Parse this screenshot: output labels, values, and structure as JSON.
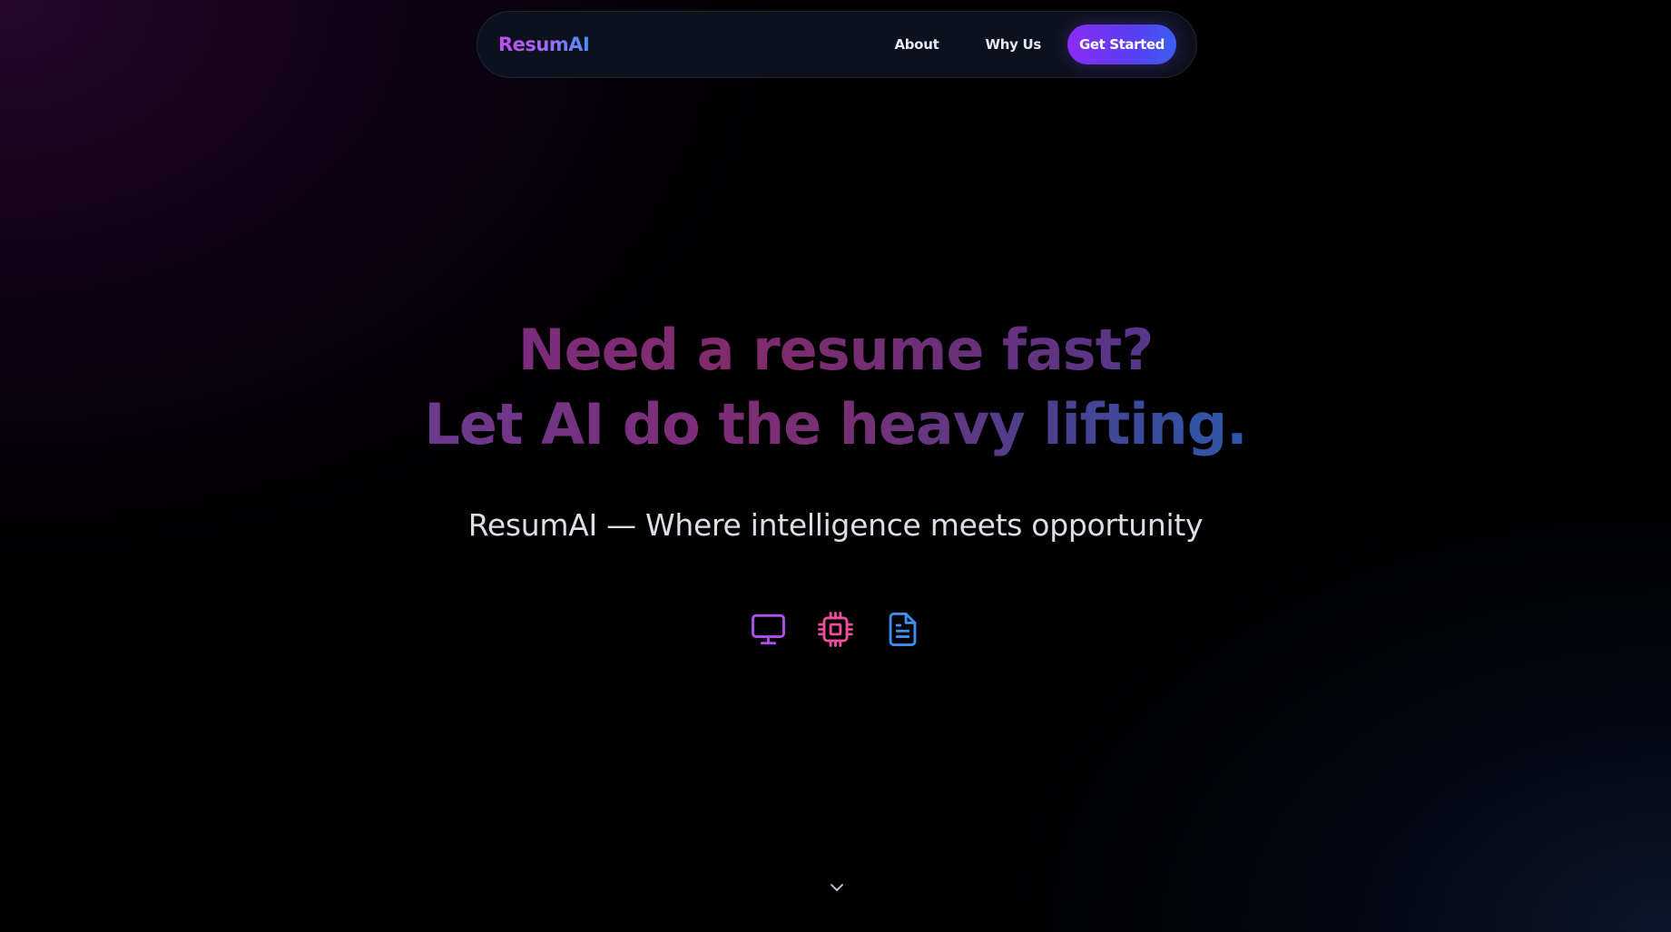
{
  "nav": {
    "logo": "ResumAI",
    "links": [
      {
        "label": "About"
      },
      {
        "label": "Why Us"
      }
    ],
    "cta_label": "Get Started"
  },
  "hero": {
    "line1": "Need a resume fast?",
    "line2": "Let AI do the heavy lifting.",
    "tagline": "ResumAI — Where intelligence meets opportunity"
  },
  "feature_icons": [
    {
      "icon": "monitor-icon",
      "color": "#b44cf0"
    },
    {
      "icon": "cpu-chip-icon",
      "color": "#ec4f9a"
    },
    {
      "icon": "document-icon",
      "color": "#3f8ef0"
    }
  ],
  "scroll_indicator": {
    "icon": "chevron-down-icon",
    "color": "#b8bcc8"
  },
  "colors": {
    "background": "#000000",
    "accent_purple": "#8a2cf5",
    "accent_blue": "#3b5ef0",
    "text_primary": "#e6e8ef"
  }
}
